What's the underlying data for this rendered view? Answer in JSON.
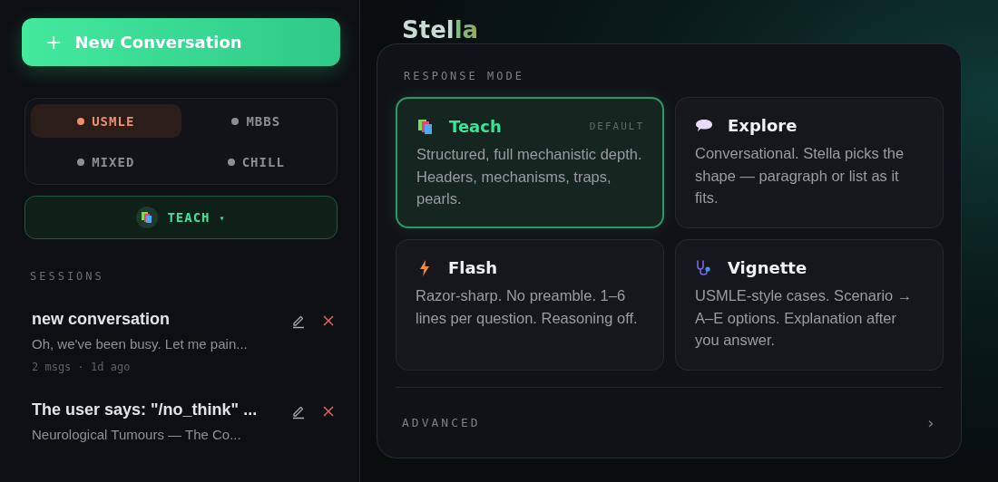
{
  "sidebar": {
    "new_button": {
      "icon": "+",
      "label": "New Conversation"
    },
    "tracks": [
      {
        "label": "USMLE",
        "selected": true
      },
      {
        "label": "MBBS",
        "selected": false
      },
      {
        "label": "MIXED",
        "selected": false
      },
      {
        "label": "CHILL",
        "selected": false
      }
    ],
    "mode_dropdown": {
      "kind": "teach",
      "label": "TEACH",
      "caret": "▾"
    },
    "sessions_heading": "SESSIONS",
    "sessions": [
      {
        "title": "new conversation",
        "preview": "Oh, we've been busy. Let me pain...",
        "meta": "2 msgs · 1d ago"
      },
      {
        "title": "The user says: \"/no_think\" ...",
        "preview": "Neurological Tumours — The Co..."
      }
    ]
  },
  "main": {
    "brand": "Stella",
    "panel": {
      "heading": "RESPONSE MODE",
      "modes": [
        {
          "kind": "teach",
          "name": "Teach",
          "badge": "DEFAULT",
          "description": "Structured, full mechanistic depth. Headers, mechanisms, traps, pearls.",
          "selected": true
        },
        {
          "kind": "explore",
          "name": "Explore",
          "description": "Conversational. Stella picks the shape — paragraph or list as it fits.",
          "selected": false
        },
        {
          "kind": "flash",
          "name": "Flash",
          "description": "Razor-sharp. No preamble. 1–6 lines per question. Reasoning off.",
          "selected": false
        },
        {
          "kind": "vignette",
          "name": "Vignette",
          "description": "USMLE-style cases. Scenario → A–E options. Explanation after you answer.",
          "selected": false
        }
      ],
      "advanced": {
        "label": "ADVANCED",
        "chevron": "›"
      }
    }
  }
}
